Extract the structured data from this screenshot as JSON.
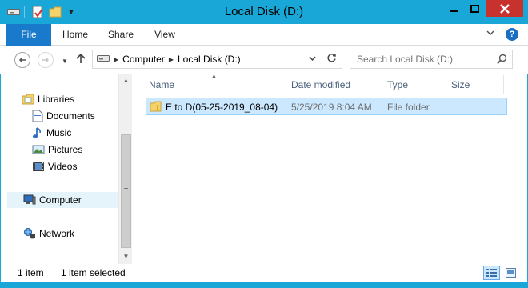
{
  "window": {
    "title": "Local Disk (D:)"
  },
  "ribbon": {
    "tabs": [
      "File",
      "Home",
      "Share",
      "View"
    ]
  },
  "address": {
    "crumbs": [
      "Computer",
      "Local Disk (D:)"
    ]
  },
  "search": {
    "placeholder": "Search Local Disk (D:)"
  },
  "nav": {
    "items": [
      {
        "label": "Libraries",
        "icon": "libraries-icon"
      },
      {
        "label": "Documents",
        "icon": "documents-icon"
      },
      {
        "label": "Music",
        "icon": "music-icon"
      },
      {
        "label": "Pictures",
        "icon": "pictures-icon"
      },
      {
        "label": "Videos",
        "icon": "videos-icon"
      },
      {
        "label": "Computer",
        "icon": "computer-icon",
        "selected": true
      },
      {
        "label": "Network",
        "icon": "network-icon"
      }
    ]
  },
  "columns": {
    "name": "Name",
    "date": "Date modified",
    "type": "Type",
    "size": "Size"
  },
  "files": [
    {
      "name": "E to D(05-25-2019_08-04)",
      "date": "5/25/2019 8:04 AM",
      "type": "File folder",
      "size": "",
      "selected": true
    }
  ],
  "status": {
    "count": "1 item",
    "selection": "1 item selected"
  },
  "colors": {
    "frame": "#19a7d7",
    "file_tab": "#1979ca",
    "close": "#c7322f",
    "selection": "#cce8ff",
    "selection_border": "#99d1ff"
  }
}
